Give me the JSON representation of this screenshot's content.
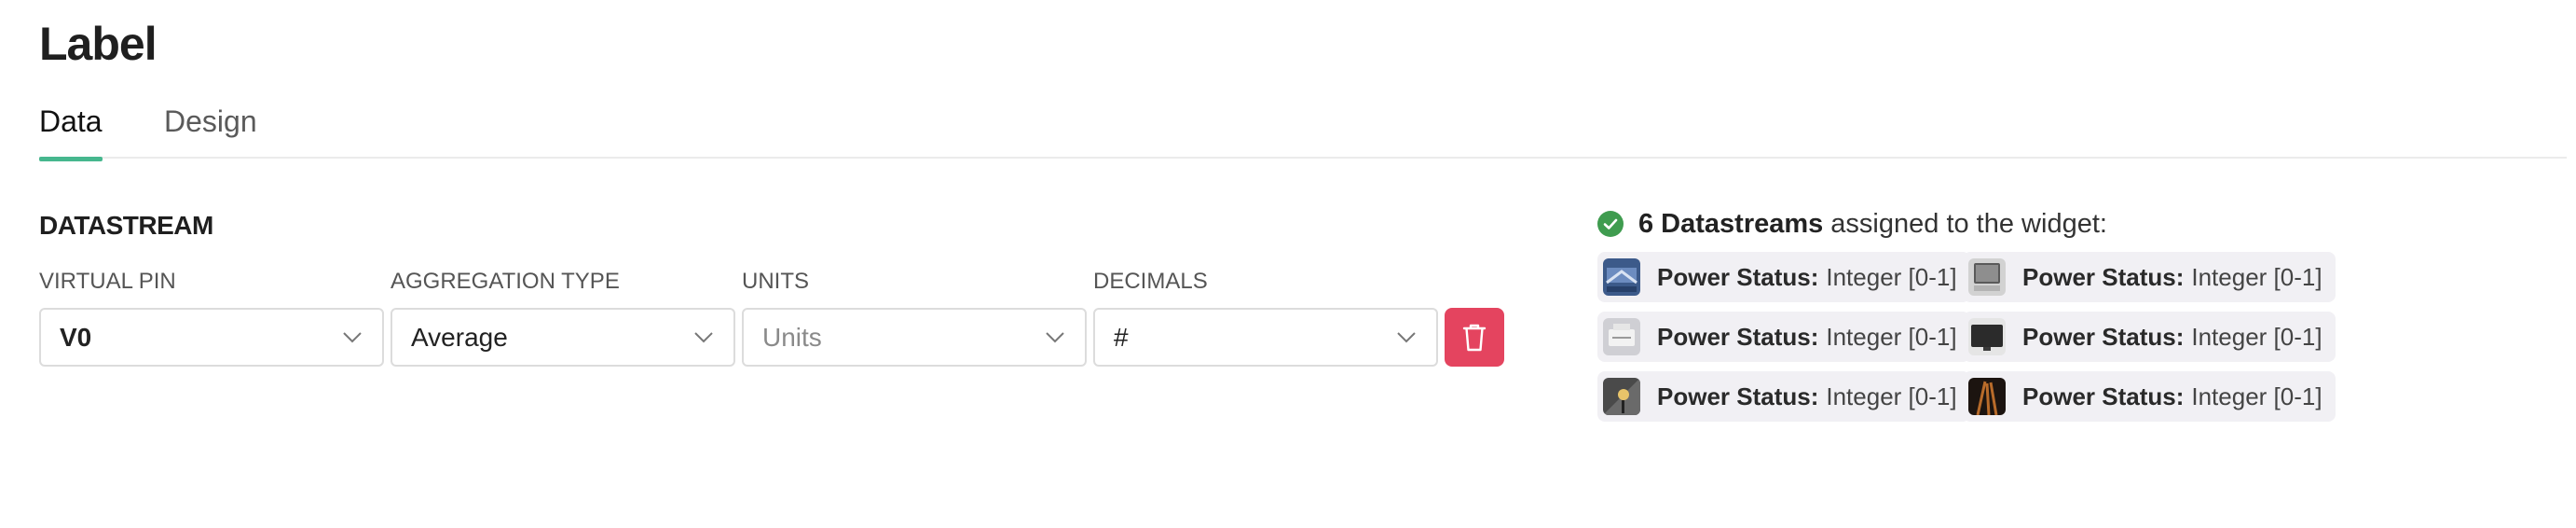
{
  "page": {
    "title": "Label"
  },
  "tabs": [
    {
      "label": "Data",
      "active": true
    },
    {
      "label": "Design",
      "active": false
    }
  ],
  "datastream": {
    "section_title": "DATASTREAM",
    "fields": [
      {
        "label": "VIRTUAL PIN",
        "value": "V0",
        "placeholder": false
      },
      {
        "label": "AGGREGATION TYPE",
        "value": "Average",
        "placeholder": false
      },
      {
        "label": "UNITS",
        "value": "Units",
        "placeholder": true
      },
      {
        "label": "DECIMALS",
        "value": "#",
        "placeholder": false
      }
    ]
  },
  "assigned": {
    "count_text": "6 Datastreams",
    "rest_text": "assigned to the widget:",
    "status_color": "#3f9c4f",
    "items": [
      {
        "label": "Power Status:",
        "type": "Integer [0-1]",
        "thumb": "blue-appliance-thumb"
      },
      {
        "label": "Power Status:",
        "type": "Integer [0-1]",
        "thumb": "gray-device-thumb"
      },
      {
        "label": "Power Status:",
        "type": "Integer [0-1]",
        "thumb": "white-printer-thumb"
      },
      {
        "label": "Power Status:",
        "type": "Integer [0-1]",
        "thumb": "black-monitor-thumb"
      },
      {
        "label": "Power Status:",
        "type": "Integer [0-1]",
        "thumb": "lamp-thumb"
      },
      {
        "label": "Power Status:",
        "type": "Integer [0-1]",
        "thumb": "dark-brown-thumb"
      }
    ]
  },
  "colors": {
    "accent": "#46b78e",
    "danger": "#e4445f",
    "chip_bg": "#f1f0f4"
  }
}
